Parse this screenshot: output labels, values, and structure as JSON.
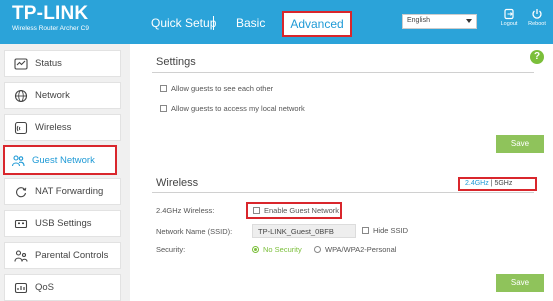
{
  "header": {
    "brand": "TP-LINK",
    "model": "Wireless Router Archer C9",
    "nav": {
      "quick_setup": "Quick Setup",
      "basic": "Basic",
      "advanced": "Advanced"
    },
    "language": "English",
    "logout": "Logout",
    "reboot": "Reboot",
    "colors": {
      "header_bg": "#2ba3d9",
      "highlight": "#d9262c",
      "accent_green": "#8fc35b"
    }
  },
  "sidebar": {
    "items": [
      {
        "label": "Status",
        "icon": "status-icon"
      },
      {
        "label": "Network",
        "icon": "globe-icon"
      },
      {
        "label": "Wireless",
        "icon": "wireless-icon"
      },
      {
        "label": "Guest Network",
        "icon": "guest-network-icon",
        "active": true
      },
      {
        "label": "NAT Forwarding",
        "icon": "nat-forwarding-icon"
      },
      {
        "label": "USB Settings",
        "icon": "usb-icon"
      },
      {
        "label": "Parental Controls",
        "icon": "parental-controls-icon"
      },
      {
        "label": "QoS",
        "icon": "qos-icon"
      }
    ]
  },
  "settings": {
    "title": "Settings",
    "allow_see_each_other": "Allow guests to see each other",
    "allow_local_network": "Allow guests to access my local network",
    "save": "Save"
  },
  "wireless": {
    "title": "Wireless",
    "band_24": "2.4GHz",
    "band_sep": "|",
    "band_5": "5GHz",
    "band_label": "2.4GHz Wireless:",
    "enable_guest": "Enable Guest Network",
    "ssid_label": "Network Name (SSID):",
    "ssid_value": "TP-LINK_Guest_0BFB",
    "hide_ssid": "Hide SSID",
    "security_label": "Security:",
    "no_security": "No Security",
    "wpa": "WPA/WPA2-Personal",
    "save": "Save"
  },
  "help": "?"
}
